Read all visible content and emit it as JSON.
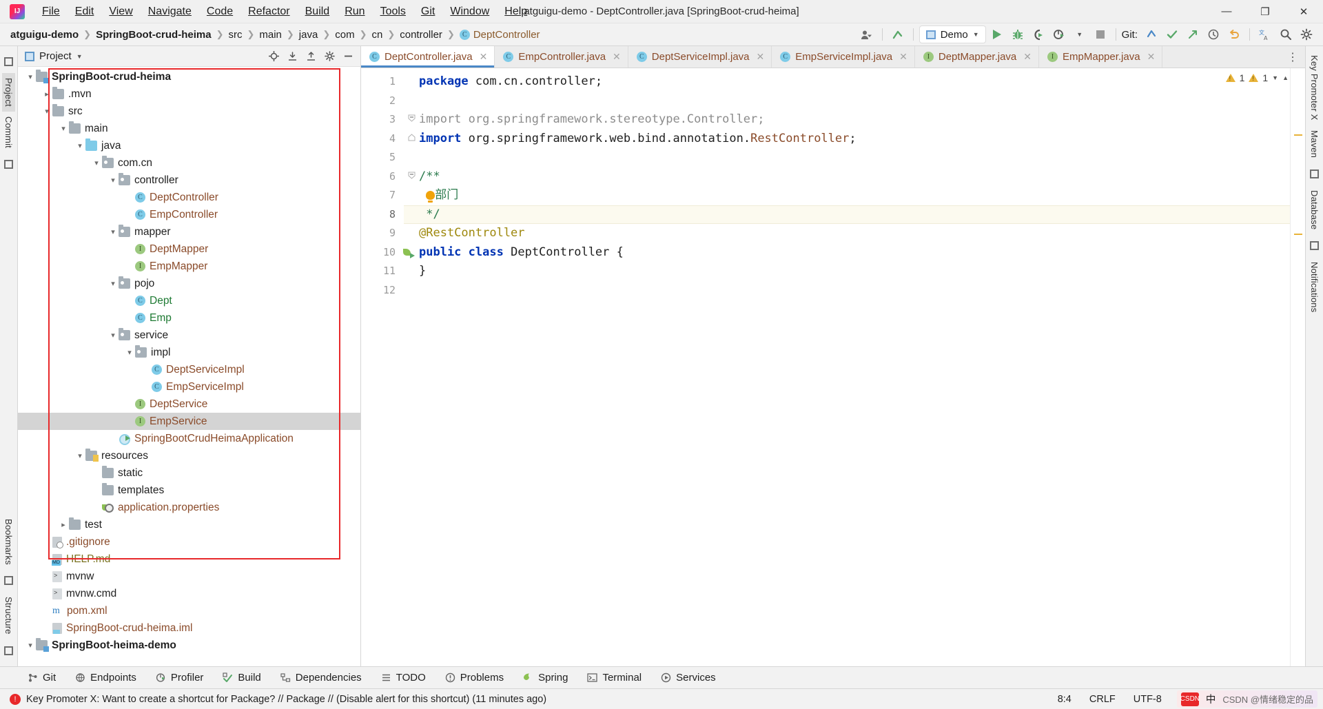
{
  "window": {
    "title": "atguigu-demo - DeptController.java [SpringBoot-crud-heima]",
    "logo": "intellij-idea-logo",
    "minimize": "—",
    "maximize": "❐",
    "close": "✕"
  },
  "menubar": [
    {
      "label": "File"
    },
    {
      "label": "Edit"
    },
    {
      "label": "View"
    },
    {
      "label": "Navigate"
    },
    {
      "label": "Code"
    },
    {
      "label": "Refactor"
    },
    {
      "label": "Build"
    },
    {
      "label": "Run"
    },
    {
      "label": "Tools"
    },
    {
      "label": "Git"
    },
    {
      "label": "Window"
    },
    {
      "label": "Help"
    }
  ],
  "breadcrumbs": [
    {
      "label": "atguigu-demo",
      "bold": true
    },
    {
      "label": "SpringBoot-crud-heima",
      "bold": true
    },
    {
      "label": "src"
    },
    {
      "label": "main"
    },
    {
      "label": "java"
    },
    {
      "label": "com"
    },
    {
      "label": "cn"
    },
    {
      "label": "controller"
    },
    {
      "label": "DeptController",
      "class": true
    }
  ],
  "toolbar": {
    "run_config": "Demo",
    "git_label": "Git:",
    "run_tooltip": "Run",
    "debug_tooltip": "Debug",
    "coverage_tooltip": "Run with Coverage",
    "profiler_tooltip": "Profiler",
    "stop_tooltip": "Stop"
  },
  "left_stripe": [
    {
      "label": "Project",
      "selected": true
    },
    {
      "label": "Commit",
      "selected": false
    },
    {
      "label": "Bookmarks",
      "selected": false
    },
    {
      "label": "Structure",
      "selected": false
    }
  ],
  "right_stripe": [
    {
      "label": "Key Promoter X"
    },
    {
      "label": "Maven"
    },
    {
      "label": "Database"
    },
    {
      "label": "Notifications"
    }
  ],
  "project_panel": {
    "title": "Project",
    "tree": [
      {
        "depth": 0,
        "label": "SpringBoot-crud-heima",
        "icon": "folder-module",
        "arrow": "open",
        "style": "bold"
      },
      {
        "depth": 1,
        "label": ".mvn",
        "icon": "folder",
        "arrow": "closed",
        "style": "dark"
      },
      {
        "depth": 1,
        "label": "src",
        "icon": "folder",
        "arrow": "open",
        "style": "dark"
      },
      {
        "depth": 2,
        "label": "main",
        "icon": "folder",
        "arrow": "open",
        "style": "dark"
      },
      {
        "depth": 3,
        "label": "java",
        "icon": "folder-source",
        "arrow": "open",
        "style": "dark"
      },
      {
        "depth": 4,
        "label": "com.cn",
        "icon": "folder-package",
        "arrow": "open",
        "style": "dark"
      },
      {
        "depth": 5,
        "label": "controller",
        "icon": "folder-package",
        "arrow": "open",
        "style": "dark"
      },
      {
        "depth": 6,
        "label": "DeptController",
        "icon": "class",
        "arrow": "none",
        "style": "brown"
      },
      {
        "depth": 6,
        "label": "EmpController",
        "icon": "class",
        "arrow": "none",
        "style": "brown"
      },
      {
        "depth": 5,
        "label": "mapper",
        "icon": "folder-package",
        "arrow": "open",
        "style": "dark"
      },
      {
        "depth": 6,
        "label": "DeptMapper",
        "icon": "interface",
        "arrow": "none",
        "style": "brown"
      },
      {
        "depth": 6,
        "label": "EmpMapper",
        "icon": "interface",
        "arrow": "none",
        "style": "brown"
      },
      {
        "depth": 5,
        "label": "pojo",
        "icon": "folder-package",
        "arrow": "open",
        "style": "dark"
      },
      {
        "depth": 6,
        "label": "Dept",
        "icon": "class",
        "arrow": "none",
        "style": "green"
      },
      {
        "depth": 6,
        "label": "Emp",
        "icon": "class",
        "arrow": "none",
        "style": "green"
      },
      {
        "depth": 5,
        "label": "service",
        "icon": "folder-package",
        "arrow": "open",
        "style": "dark"
      },
      {
        "depth": 6,
        "label": "impl",
        "icon": "folder-package",
        "arrow": "open",
        "style": "dark"
      },
      {
        "depth": 7,
        "label": "DeptServiceImpl",
        "icon": "class",
        "arrow": "none",
        "style": "brown"
      },
      {
        "depth": 7,
        "label": "EmpServiceImpl",
        "icon": "class",
        "arrow": "none",
        "style": "brown"
      },
      {
        "depth": 6,
        "label": "DeptService",
        "icon": "interface",
        "arrow": "none",
        "style": "brown"
      },
      {
        "depth": 6,
        "label": "EmpService",
        "icon": "interface",
        "arrow": "none",
        "style": "brown",
        "selected": true
      },
      {
        "depth": 5,
        "label": "SpringBootCrudHeimaApplication",
        "icon": "spring-class",
        "arrow": "none",
        "style": "brown"
      },
      {
        "depth": 3,
        "label": "resources",
        "icon": "folder-resources",
        "arrow": "open",
        "style": "dark"
      },
      {
        "depth": 4,
        "label": "static",
        "icon": "folder",
        "arrow": "none",
        "style": "dark"
      },
      {
        "depth": 4,
        "label": "templates",
        "icon": "folder",
        "arrow": "none",
        "style": "dark"
      },
      {
        "depth": 4,
        "label": "application.properties",
        "icon": "spring-properties",
        "arrow": "none",
        "style": "brown"
      },
      {
        "depth": 2,
        "label": "test",
        "icon": "folder",
        "arrow": "closed",
        "style": "dark"
      },
      {
        "depth": 1,
        "label": ".gitignore",
        "icon": "file-gitignore",
        "arrow": "none",
        "style": "brown"
      },
      {
        "depth": 1,
        "label": "HELP.md",
        "icon": "file-md",
        "arrow": "none",
        "style": "olive"
      },
      {
        "depth": 1,
        "label": "mvnw",
        "icon": "file-mvnw",
        "arrow": "none",
        "style": "dark"
      },
      {
        "depth": 1,
        "label": "mvnw.cmd",
        "icon": "file-mvnw",
        "arrow": "none",
        "style": "dark"
      },
      {
        "depth": 1,
        "label": "pom.xml",
        "icon": "file-maven",
        "arrow": "none",
        "style": "brown"
      },
      {
        "depth": 1,
        "label": "SpringBoot-crud-heima.iml",
        "icon": "file-iml",
        "arrow": "none",
        "style": "brown"
      },
      {
        "depth": 0,
        "label": "SpringBoot-heima-demo",
        "icon": "folder-module",
        "arrow": "open",
        "style": "bold"
      }
    ]
  },
  "editor": {
    "tabs": [
      {
        "label": "DeptController.java",
        "icon": "class",
        "active": true
      },
      {
        "label": "EmpController.java",
        "icon": "class",
        "active": false
      },
      {
        "label": "DeptServiceImpl.java",
        "icon": "class",
        "active": false
      },
      {
        "label": "EmpServiceImpl.java",
        "icon": "class",
        "active": false
      },
      {
        "label": "DeptMapper.java",
        "icon": "interface",
        "active": false
      },
      {
        "label": "EmpMapper.java",
        "icon": "interface",
        "active": false
      }
    ],
    "code_lines": [
      {
        "n": "1",
        "text": "package com.cn.controller;"
      },
      {
        "n": "2",
        "text": ""
      },
      {
        "n": "3",
        "text": "import org.springframework.stereotype.Controller;"
      },
      {
        "n": "4",
        "text": "import org.springframework.web.bind.annotation.RestController;"
      },
      {
        "n": "5",
        "text": ""
      },
      {
        "n": "6",
        "text": "/**"
      },
      {
        "n": "7",
        "text": " 部门"
      },
      {
        "n": "8",
        "text": " */"
      },
      {
        "n": "9",
        "text": "@RestController"
      },
      {
        "n": "10",
        "text": "public class DeptController {"
      },
      {
        "n": "11",
        "text": "}"
      },
      {
        "n": "12",
        "text": ""
      }
    ],
    "inspection_warnings": "1",
    "inspection_weak": "1"
  },
  "bottom_bar": [
    {
      "label": "Git",
      "icon": "git-icon"
    },
    {
      "label": "Endpoints",
      "icon": "endpoints-icon"
    },
    {
      "label": "Profiler",
      "icon": "profiler-icon"
    },
    {
      "label": "Build",
      "icon": "build-icon"
    },
    {
      "label": "Dependencies",
      "icon": "dependencies-icon"
    },
    {
      "label": "TODO",
      "icon": "todo-icon"
    },
    {
      "label": "Problems",
      "icon": "problems-icon"
    },
    {
      "label": "Spring",
      "icon": "spring-icon"
    },
    {
      "label": "Terminal",
      "icon": "terminal-icon"
    },
    {
      "label": "Services",
      "icon": "services-icon"
    }
  ],
  "status_bar": {
    "message": "Key Promoter X: Want to create a shortcut for Package? // Package // (Disable alert for this shortcut) (11 minutes ago)",
    "caret": "8:4",
    "line_sep": "CRLF",
    "encoding": "UTF-8",
    "ime": "中",
    "watermark": "CSDN @情绪稳定的品"
  },
  "colors": {
    "accent_blue": "#4a88c7",
    "run_green": "#59a869",
    "red_box": "#e8282a",
    "brown_text": "#8a4b2a",
    "green_text": "#1e7a33",
    "keyword_blue": "#0033b3",
    "annotation_olive": "#9e880d",
    "comment_green": "#2a7a4c"
  }
}
